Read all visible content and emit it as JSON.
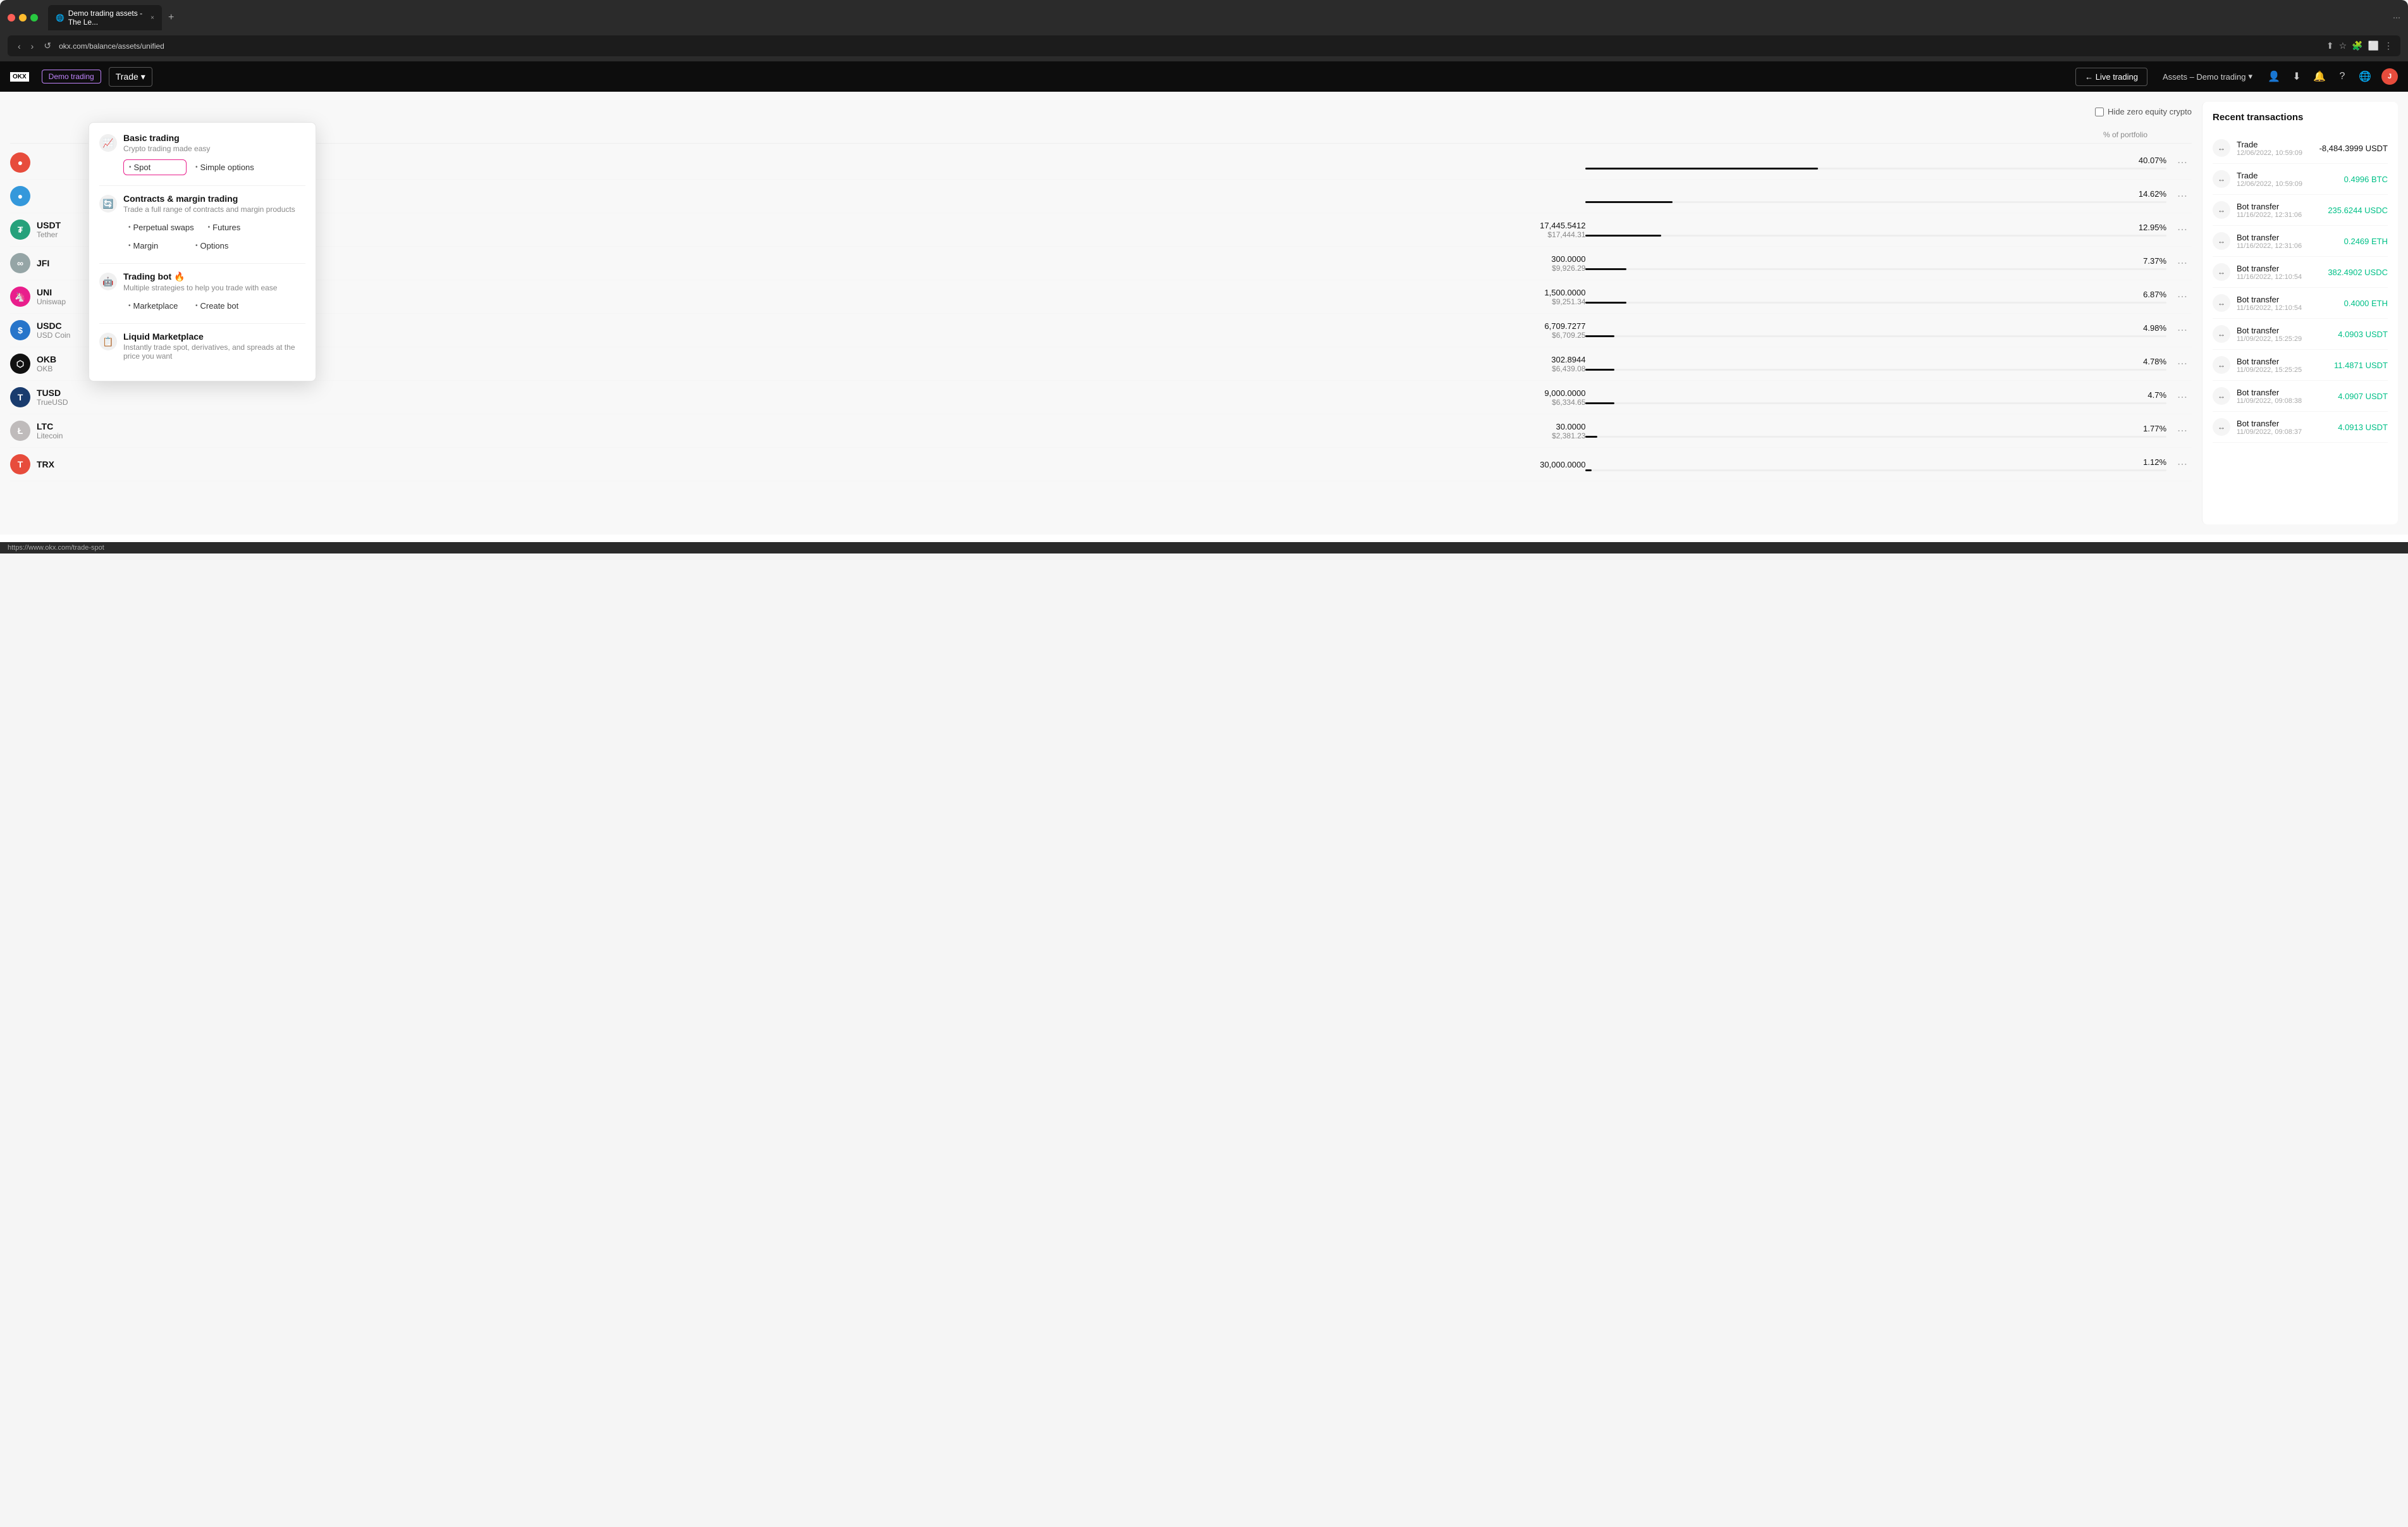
{
  "browser": {
    "tab_title": "Demo trading assets - The Le...",
    "url": "okx.com/balance/assets/unified",
    "new_tab_label": "+",
    "close_label": "×"
  },
  "header": {
    "logo_text": "OKX",
    "demo_badge": "Demo trading",
    "trade_label": "Trade",
    "trade_chevron": "▾",
    "live_trading_label": "← Live trading",
    "assets_label": "Assets – Demo trading",
    "assets_chevron": "▾",
    "avatar_initials": "J"
  },
  "dropdown": {
    "basic_trading_title": "Basic trading",
    "basic_trading_subtitle": "Crypto trading made easy",
    "spot_label": "Spot",
    "simple_options_label": "Simple options",
    "contracts_title": "Contracts & margin trading",
    "contracts_subtitle": "Trade a full range of contracts and margin products",
    "perpetual_swaps_label": "Perpetual swaps",
    "futures_label": "Futures",
    "margin_label": "Margin",
    "options_label": "Options",
    "trading_bot_title": "Trading bot",
    "trading_bot_fire": "🔥",
    "trading_bot_subtitle": "Multiple strategies to help you trade with ease",
    "marketplace_label": "Marketplace",
    "create_bot_label": "Create bot",
    "liquid_marketplace_title": "Liquid Marketplace",
    "liquid_marketplace_subtitle": "Instantly trade spot, derivatives, and spreads at the price you want"
  },
  "table": {
    "hide_zero_label": "Hide zero equity crypto",
    "col_portfolio": "% of portfolio",
    "assets": [
      {
        "symbol": "",
        "name": "",
        "amount_primary": "",
        "amount_usd": "",
        "portfolio_pct": "40.07%",
        "portfolio_width": "40",
        "icon_color": "#e74c3c",
        "icon_text": "●"
      },
      {
        "symbol": "",
        "name": "",
        "amount_primary": "",
        "amount_usd": "",
        "portfolio_pct": "14.62%",
        "portfolio_width": "15",
        "icon_color": "#3498db",
        "icon_text": "●"
      },
      {
        "symbol": "USDT",
        "name": "Tether",
        "amount_primary": "17,445.5412",
        "amount_usd": "$17,444.31",
        "portfolio_pct": "12.95%",
        "portfolio_width": "13",
        "icon_color": "#26a17b",
        "icon_text": "₮"
      },
      {
        "symbol": "JFI",
        "name": "",
        "amount_primary": "300.0000",
        "amount_usd": "$9,926.29",
        "portfolio_pct": "7.37%",
        "portfolio_width": "7",
        "icon_color": "#95a5a6",
        "icon_text": "∞"
      },
      {
        "symbol": "UNI",
        "name": "Uniswap",
        "amount_primary": "1,500.0000",
        "amount_usd": "$9,251.34",
        "portfolio_pct": "6.87%",
        "portfolio_width": "7",
        "icon_color": "#e91e8c",
        "icon_text": "🦄"
      },
      {
        "symbol": "USDC",
        "name": "USD Coin",
        "amount_primary": "6,709.7277",
        "amount_usd": "$6,709.25",
        "portfolio_pct": "4.98%",
        "portfolio_width": "5",
        "icon_color": "#2775ca",
        "icon_text": "$"
      },
      {
        "symbol": "OKB",
        "name": "OKB",
        "amount_primary": "302.8944",
        "amount_usd": "$6,439.08",
        "portfolio_pct": "4.78%",
        "portfolio_width": "5",
        "icon_color": "#111",
        "icon_text": "⬡"
      },
      {
        "symbol": "TUSD",
        "name": "TrueUSD",
        "amount_primary": "9,000.0000",
        "amount_usd": "$6,334.65",
        "portfolio_pct": "4.7%",
        "portfolio_width": "5",
        "icon_color": "#1a3c6e",
        "icon_text": "T"
      },
      {
        "symbol": "LTC",
        "name": "Litecoin",
        "amount_primary": "30.0000",
        "amount_usd": "$2,381.23",
        "portfolio_pct": "1.77%",
        "portfolio_width": "2",
        "icon_color": "#bfbbbb",
        "icon_text": "Ł"
      },
      {
        "symbol": "TRX",
        "name": "",
        "amount_primary": "30,000.0000",
        "amount_usd": "",
        "portfolio_pct": "1.12%",
        "portfolio_width": "1",
        "icon_color": "#e74c3c",
        "icon_text": "T"
      }
    ]
  },
  "recent_transactions": {
    "title": "Recent transactions",
    "items": [
      {
        "type": "Trade",
        "date": "12/06/2022, 10:59:09",
        "amount": "-8,484.3999 USDT",
        "amount_sign": "negative"
      },
      {
        "type": "Trade",
        "date": "12/06/2022, 10:59:09",
        "amount": "0.4996 BTC",
        "amount_sign": "positive"
      },
      {
        "type": "Bot transfer",
        "date": "11/16/2022, 12:31:06",
        "amount": "235.6244 USDC",
        "amount_sign": "positive"
      },
      {
        "type": "Bot transfer",
        "date": "11/16/2022, 12:31:06",
        "amount": "0.2469 ETH",
        "amount_sign": "positive"
      },
      {
        "type": "Bot transfer",
        "date": "11/16/2022, 12:10:54",
        "amount": "382.4902 USDC",
        "amount_sign": "positive"
      },
      {
        "type": "Bot transfer",
        "date": "11/16/2022, 12:10:54",
        "amount": "0.4000 ETH",
        "amount_sign": "positive"
      },
      {
        "type": "Bot transfer",
        "date": "11/09/2022, 15:25:29",
        "amount": "4.0903 USDT",
        "amount_sign": "positive"
      },
      {
        "type": "Bot transfer",
        "date": "11/09/2022, 15:25:25",
        "amount": "11.4871 USDT",
        "amount_sign": "positive"
      },
      {
        "type": "Bot transfer",
        "date": "11/09/2022, 09:08:38",
        "amount": "4.0907 USDT",
        "amount_sign": "positive"
      },
      {
        "type": "Bot transfer",
        "date": "11/09/2022, 09:08:37",
        "amount": "4.0913 USDT",
        "amount_sign": "positive"
      }
    ]
  },
  "status_bar": {
    "url": "https://www.okx.com/trade-spot"
  },
  "colors": {
    "accent_pink": "#e91e8c",
    "positive_green": "#00c087",
    "header_bg": "#0d0d0d",
    "dropdown_bg": "#ffffff"
  }
}
